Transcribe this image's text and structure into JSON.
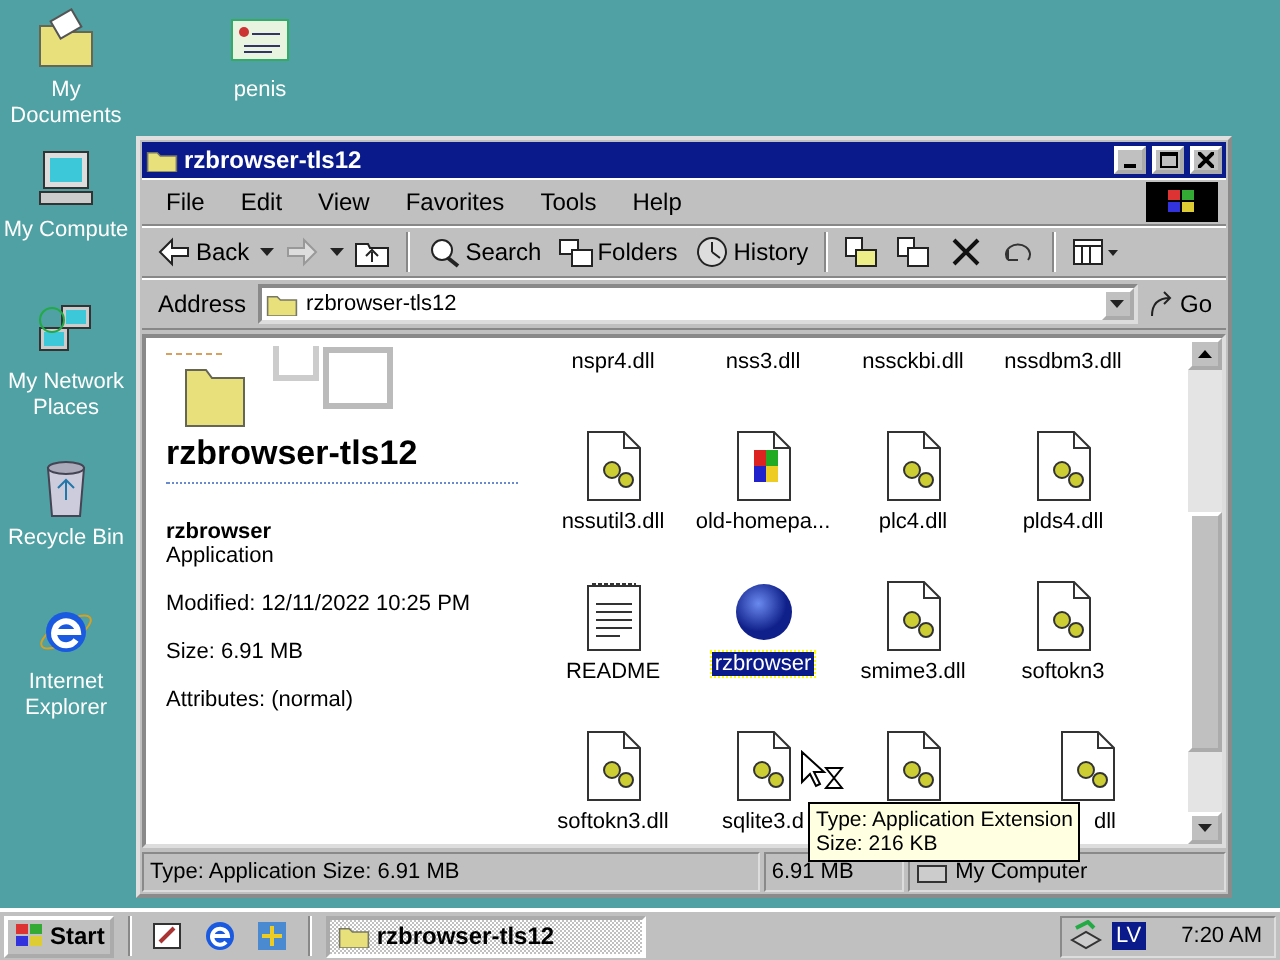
{
  "desktop": {
    "icons": [
      {
        "label": "My Documents",
        "kind": "documents"
      },
      {
        "label": "penis",
        "kind": "certificate"
      },
      {
        "label": "My Compute",
        "kind": "computer"
      },
      {
        "label": "My Network Places",
        "kind": "network"
      },
      {
        "label": "Recycle Bin",
        "kind": "recycle"
      },
      {
        "label": "Internet Explorer",
        "kind": "ie"
      }
    ]
  },
  "window": {
    "title": "rzbrowser-tls12",
    "menu": [
      "File",
      "Edit",
      "View",
      "Favorites",
      "Tools",
      "Help"
    ],
    "toolbar": [
      {
        "kind": "back",
        "label": "Back"
      },
      {
        "kind": "forward"
      },
      {
        "kind": "up"
      },
      {
        "kind": "search",
        "label": "Search"
      },
      {
        "kind": "folders",
        "label": "Folders"
      },
      {
        "kind": "history",
        "label": "History"
      },
      {
        "kind": "move"
      },
      {
        "kind": "copy"
      },
      {
        "kind": "delete"
      },
      {
        "kind": "undo"
      },
      {
        "kind": "views"
      }
    ],
    "address": {
      "label": "Address",
      "value": "rzbrowser-tls12",
      "go": "Go"
    },
    "info_pane": {
      "title": "rzbrowser-tls12",
      "name": "rzbrowser",
      "type": "Application",
      "modified": "Modified: 12/11/2022 10:25 PM",
      "size": "Size: 6.91 MB",
      "attributes": "Attributes: (normal)"
    },
    "files": [
      {
        "label": "nspr4.dll",
        "kind": "label",
        "selected": false
      },
      {
        "label": "nss3.dll",
        "kind": "label",
        "selected": false
      },
      {
        "label": "nssckbi.dll",
        "kind": "label",
        "selected": false
      },
      {
        "label": "nssdbm3.dll",
        "kind": "label",
        "selected": false
      },
      {
        "label": "nssutil3.dll",
        "kind": "dll",
        "selected": false
      },
      {
        "label": "old-homepa...",
        "kind": "installer",
        "selected": false
      },
      {
        "label": "plc4.dll",
        "kind": "dll",
        "selected": false
      },
      {
        "label": "plds4.dll",
        "kind": "dll",
        "selected": false
      },
      {
        "label": "README",
        "kind": "text",
        "selected": false
      },
      {
        "label": "rzbrowser",
        "kind": "app",
        "selected": true
      },
      {
        "label": "smime3.dll",
        "kind": "dll",
        "selected": false
      },
      {
        "label": "softokn3",
        "kind": "dll",
        "selected": false
      },
      {
        "label": "softokn3.dll",
        "kind": "dll",
        "selected": false
      },
      {
        "label": "sqlite3.d",
        "kind": "dll",
        "selected": false
      },
      {
        "kind": "dll",
        "selected": false
      },
      {
        "label": "dll",
        "kind": "dll",
        "selected": false
      }
    ],
    "tooltip": [
      "Type: Application Extension",
      "Size: 216 KB"
    ],
    "status_bar": [
      "Type: Application Size: 6.91 MB",
      "6.91 MB",
      "My Computer"
    ]
  },
  "taskbar": {
    "start": "Start",
    "quick_launch": [
      {
        "kind": "desktop"
      },
      {
        "kind": "ie"
      },
      {
        "kind": "channels"
      }
    ],
    "tasks": [
      {
        "label": "rzbrowser-tls12",
        "selected": true
      }
    ],
    "tray": {
      "language": "LV",
      "clock": "7:20 AM"
    }
  }
}
